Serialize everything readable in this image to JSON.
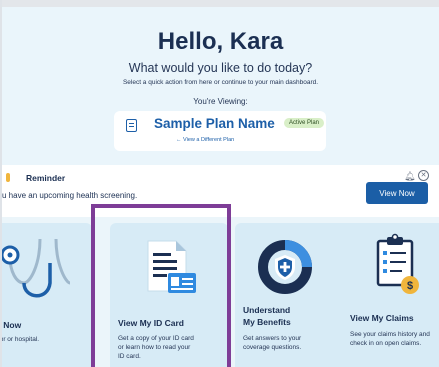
{
  "hero": {
    "greeting": "Hello, Kara",
    "subtitle": "What would you like to do today?",
    "helper": "Select a quick action from here or continue to your main dashboard.",
    "viewing_label": "You're Viewing:"
  },
  "plan": {
    "name": "Sample Plan Name",
    "badge": "Active Plan",
    "switch_link": "← View a Different Plan"
  },
  "reminder": {
    "title": "Reminder",
    "text": "u have an upcoming health screening.",
    "button": "View Now",
    "bell_icon": "bell-icon",
    "close_icon": "close-circle-icon"
  },
  "cards": [
    {
      "title": "Care Now",
      "desc_line1": "a doctor or hospital.",
      "icon": "stethoscope-icon"
    },
    {
      "title": "View My ID Card",
      "desc_line1": "Get a copy of your ID card",
      "desc_line2": "or learn how to read your",
      "desc_line3": "ID card.",
      "icon": "id-card-icon"
    },
    {
      "title_line1": "Understand",
      "title_line2": "My Benefits",
      "desc_line1": "Get answers to your",
      "desc_line2": "coverage questions.",
      "icon": "shield-donut-icon"
    },
    {
      "title": "View My Claims",
      "desc_line1": "See your claims history and",
      "desc_line2": "check in on open claims.",
      "icon": "clipboard-dollar-icon"
    }
  ],
  "colors": {
    "brand_blue": "#1b5ea6",
    "navy": "#1b2f52",
    "highlight_purple": "#7e3d97",
    "badge_green": "#d9efc8",
    "hero_bg": "#eaf5fb",
    "card_bg": "#d7ebf6",
    "accent_orange": "#f0b53c"
  }
}
